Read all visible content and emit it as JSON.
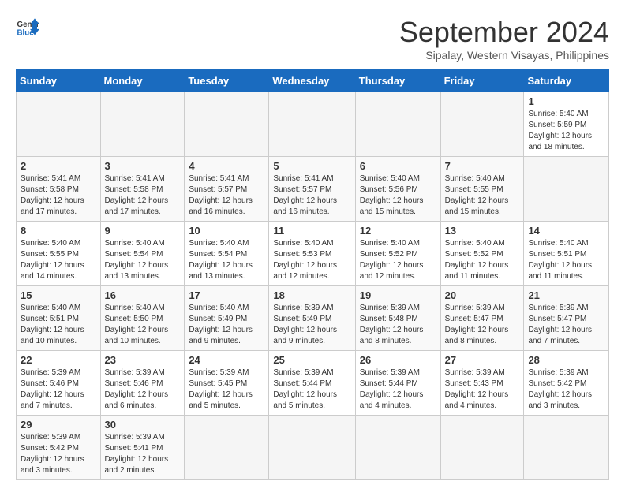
{
  "header": {
    "logo_general": "General",
    "logo_blue": "Blue",
    "month_title": "September 2024",
    "subtitle": "Sipalay, Western Visayas, Philippines"
  },
  "calendar": {
    "headers": [
      "Sunday",
      "Monday",
      "Tuesday",
      "Wednesday",
      "Thursday",
      "Friday",
      "Saturday"
    ],
    "weeks": [
      [
        {
          "day": "",
          "empty": true
        },
        {
          "day": "",
          "empty": true
        },
        {
          "day": "",
          "empty": true
        },
        {
          "day": "",
          "empty": true
        },
        {
          "day": "",
          "empty": true
        },
        {
          "day": "",
          "empty": true
        },
        {
          "day": "1",
          "sunrise": "Sunrise: 5:40 AM",
          "sunset": "Sunset: 5:59 PM",
          "daylight": "Daylight: 12 hours and 18 minutes."
        }
      ],
      [
        {
          "day": "2",
          "sunrise": "Sunrise: 5:41 AM",
          "sunset": "Sunset: 5:58 PM",
          "daylight": "Daylight: 12 hours and 17 minutes."
        },
        {
          "day": "3",
          "sunrise": "Sunrise: 5:41 AM",
          "sunset": "Sunset: 5:58 PM",
          "daylight": "Daylight: 12 hours and 17 minutes."
        },
        {
          "day": "4",
          "sunrise": "Sunrise: 5:41 AM",
          "sunset": "Sunset: 5:57 PM",
          "daylight": "Daylight: 12 hours and 16 minutes."
        },
        {
          "day": "5",
          "sunrise": "Sunrise: 5:41 AM",
          "sunset": "Sunset: 5:57 PM",
          "daylight": "Daylight: 12 hours and 16 minutes."
        },
        {
          "day": "6",
          "sunrise": "Sunrise: 5:40 AM",
          "sunset": "Sunset: 5:56 PM",
          "daylight": "Daylight: 12 hours and 15 minutes."
        },
        {
          "day": "7",
          "sunrise": "Sunrise: 5:40 AM",
          "sunset": "Sunset: 5:55 PM",
          "daylight": "Daylight: 12 hours and 15 minutes."
        }
      ],
      [
        {
          "day": "8",
          "sunrise": "Sunrise: 5:40 AM",
          "sunset": "Sunset: 5:55 PM",
          "daylight": "Daylight: 12 hours and 14 minutes."
        },
        {
          "day": "9",
          "sunrise": "Sunrise: 5:40 AM",
          "sunset": "Sunset: 5:54 PM",
          "daylight": "Daylight: 12 hours and 13 minutes."
        },
        {
          "day": "10",
          "sunrise": "Sunrise: 5:40 AM",
          "sunset": "Sunset: 5:54 PM",
          "daylight": "Daylight: 12 hours and 13 minutes."
        },
        {
          "day": "11",
          "sunrise": "Sunrise: 5:40 AM",
          "sunset": "Sunset: 5:53 PM",
          "daylight": "Daylight: 12 hours and 12 minutes."
        },
        {
          "day": "12",
          "sunrise": "Sunrise: 5:40 AM",
          "sunset": "Sunset: 5:52 PM",
          "daylight": "Daylight: 12 hours and 12 minutes."
        },
        {
          "day": "13",
          "sunrise": "Sunrise: 5:40 AM",
          "sunset": "Sunset: 5:52 PM",
          "daylight": "Daylight: 12 hours and 11 minutes."
        },
        {
          "day": "14",
          "sunrise": "Sunrise: 5:40 AM",
          "sunset": "Sunset: 5:51 PM",
          "daylight": "Daylight: 12 hours and 11 minutes."
        }
      ],
      [
        {
          "day": "15",
          "sunrise": "Sunrise: 5:40 AM",
          "sunset": "Sunset: 5:51 PM",
          "daylight": "Daylight: 12 hours and 10 minutes."
        },
        {
          "day": "16",
          "sunrise": "Sunrise: 5:40 AM",
          "sunset": "Sunset: 5:50 PM",
          "daylight": "Daylight: 12 hours and 10 minutes."
        },
        {
          "day": "17",
          "sunrise": "Sunrise: 5:40 AM",
          "sunset": "Sunset: 5:49 PM",
          "daylight": "Daylight: 12 hours and 9 minutes."
        },
        {
          "day": "18",
          "sunrise": "Sunrise: 5:39 AM",
          "sunset": "Sunset: 5:49 PM",
          "daylight": "Daylight: 12 hours and 9 minutes."
        },
        {
          "day": "19",
          "sunrise": "Sunrise: 5:39 AM",
          "sunset": "Sunset: 5:48 PM",
          "daylight": "Daylight: 12 hours and 8 minutes."
        },
        {
          "day": "20",
          "sunrise": "Sunrise: 5:39 AM",
          "sunset": "Sunset: 5:47 PM",
          "daylight": "Daylight: 12 hours and 8 minutes."
        },
        {
          "day": "21",
          "sunrise": "Sunrise: 5:39 AM",
          "sunset": "Sunset: 5:47 PM",
          "daylight": "Daylight: 12 hours and 7 minutes."
        }
      ],
      [
        {
          "day": "22",
          "sunrise": "Sunrise: 5:39 AM",
          "sunset": "Sunset: 5:46 PM",
          "daylight": "Daylight: 12 hours and 7 minutes."
        },
        {
          "day": "23",
          "sunrise": "Sunrise: 5:39 AM",
          "sunset": "Sunset: 5:46 PM",
          "daylight": "Daylight: 12 hours and 6 minutes."
        },
        {
          "day": "24",
          "sunrise": "Sunrise: 5:39 AM",
          "sunset": "Sunset: 5:45 PM",
          "daylight": "Daylight: 12 hours and 5 minutes."
        },
        {
          "day": "25",
          "sunrise": "Sunrise: 5:39 AM",
          "sunset": "Sunset: 5:44 PM",
          "daylight": "Daylight: 12 hours and 5 minutes."
        },
        {
          "day": "26",
          "sunrise": "Sunrise: 5:39 AM",
          "sunset": "Sunset: 5:44 PM",
          "daylight": "Daylight: 12 hours and 4 minutes."
        },
        {
          "day": "27",
          "sunrise": "Sunrise: 5:39 AM",
          "sunset": "Sunset: 5:43 PM",
          "daylight": "Daylight: 12 hours and 4 minutes."
        },
        {
          "day": "28",
          "sunrise": "Sunrise: 5:39 AM",
          "sunset": "Sunset: 5:42 PM",
          "daylight": "Daylight: 12 hours and 3 minutes."
        }
      ],
      [
        {
          "day": "29",
          "sunrise": "Sunrise: 5:39 AM",
          "sunset": "Sunset: 5:42 PM",
          "daylight": "Daylight: 12 hours and 3 minutes."
        },
        {
          "day": "30",
          "sunrise": "Sunrise: 5:39 AM",
          "sunset": "Sunset: 5:41 PM",
          "daylight": "Daylight: 12 hours and 2 minutes."
        },
        {
          "day": "",
          "empty": true
        },
        {
          "day": "",
          "empty": true
        },
        {
          "day": "",
          "empty": true
        },
        {
          "day": "",
          "empty": true
        },
        {
          "day": "",
          "empty": true
        }
      ]
    ]
  }
}
